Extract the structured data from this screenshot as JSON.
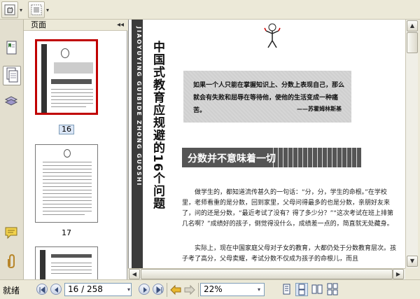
{
  "toolbar": {
    "tools": [
      "hand-tool",
      "marquee-tool"
    ]
  },
  "panel": {
    "title": "页面",
    "collapse_glyph": "◂◂",
    "thumbnails": [
      {
        "page": "16",
        "selected": true
      },
      {
        "page": "17",
        "selected": false
      }
    ]
  },
  "document": {
    "vertical_en": "JIAOYUYING GUIBIDE ZHONG GUOSHI",
    "vertical_title": "中国式教育应规避的16个问题",
    "quote_line1": "如果一个人只能在掌握知识上、分数上表现自己，那么",
    "quote_line2": "就会有失败和屈辱在等待他，使他的生活变成一种痛苦。",
    "quote_author": "——苏霍姆林斯基",
    "heading": "分数并不意味着一切",
    "para1": "做学生的，都知道流传甚久的一句话：“分，分，学生的命根。”在学校里，老师看重的是分数，回到家里，父母问得最多的也是分数，亲朋好友来了，问的还是分数，“最近考试了没有？得了多少分？”“这次考试在班上排第几名啊？”成绩好的孩子，倒觉得没什么，成绩差一点的，简直就无处藏身。",
    "para2": "实际上，现在中国家庭父母对子女的教育，大都仍处于分数教育层次。孩子考了高分，父母卖耀，考试分数不仅成为孩子的命根儿，而且"
  },
  "statusbar": {
    "status": "就绪",
    "page_field": "16 / 258",
    "zoom": "22%"
  },
  "colors": {
    "selection": "#c00000",
    "toolbar_bg": "#ece9d8",
    "heading_band": "#555555"
  }
}
